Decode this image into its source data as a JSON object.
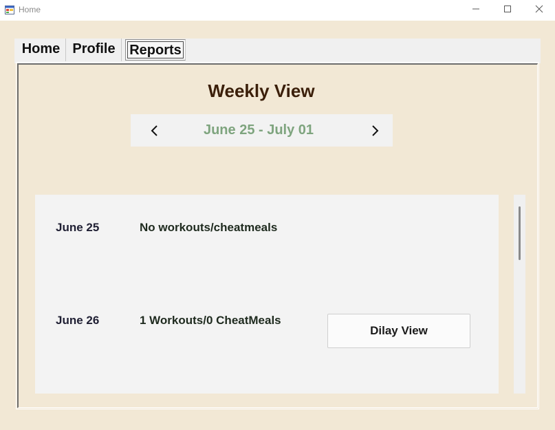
{
  "window": {
    "title": "Home",
    "icon": "app-form-icon",
    "controls": [
      "minimize-icon",
      "maximize-icon",
      "close-icon"
    ]
  },
  "tabs": [
    {
      "label": "Home",
      "selected": false
    },
    {
      "label": "Profile",
      "selected": false
    },
    {
      "label": "Reports",
      "selected": true
    }
  ],
  "reports": {
    "heading": "Weekly View",
    "week_range": "June 25 - July 01",
    "prev_icon": "chevron-left-icon",
    "next_icon": "chevron-right-icon",
    "days": [
      {
        "date": "June 25",
        "summary": "No workouts/cheatmeals"
      },
      {
        "date": "June 26",
        "summary": "1 Workouts/0 CheatMeals",
        "button_label": "Dilay View"
      }
    ]
  },
  "colors": {
    "background": "#f2e8d5",
    "heading": "#3b1f0a",
    "week_range": "#7ea47e",
    "panel": "#f3f3f3"
  }
}
